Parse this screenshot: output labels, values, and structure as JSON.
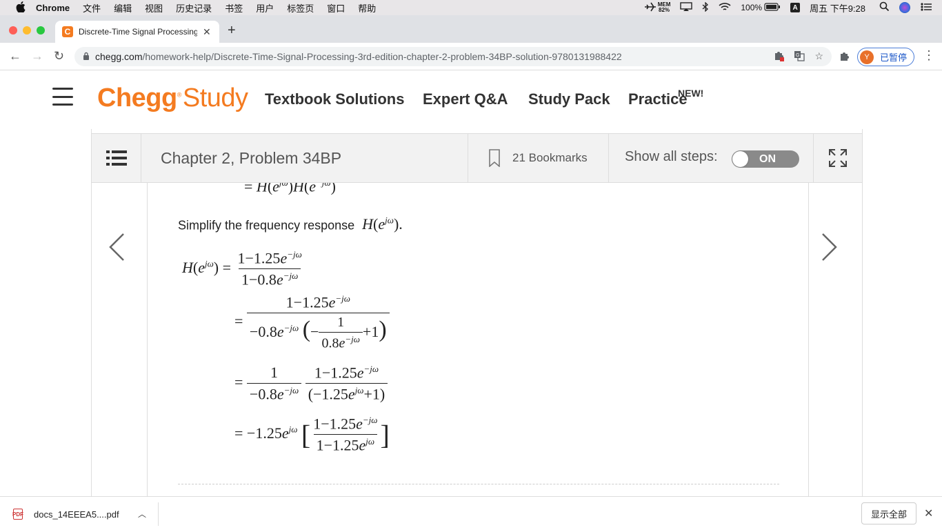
{
  "menubar": {
    "app": "Chrome",
    "items": [
      "文件",
      "编辑",
      "视图",
      "历史记录",
      "书签",
      "用户",
      "标签页",
      "窗口",
      "帮助"
    ],
    "mem_label": "MEM",
    "mem_value": "82%",
    "battery": "100%",
    "input_method": "A",
    "clock": "周五 下午9:28"
  },
  "browser": {
    "tab_title": "Discrete-Time Signal Processing",
    "url_domain": "chegg.com",
    "url_path": "/homework-help/Discrete-Time-Signal-Processing-3rd-edition-chapter-2-problem-34BP-solution-9780131988422",
    "profile_initial": "Y",
    "profile_label": "已暂停"
  },
  "chegg": {
    "logo_chegg": "Chegg",
    "logo_study": "Study",
    "nav": [
      "Textbook Solutions",
      "Expert Q&A",
      "Study Pack",
      "Practice"
    ],
    "new_badge": "NEW!"
  },
  "viewer": {
    "chapter_title": "Chapter 2, Problem 34BP",
    "bookmarks": "21 Bookmarks",
    "show_steps_label": "Show all steps:",
    "toggle_state": "ON"
  },
  "solution": {
    "prose": "Simplify the frequency response"
  },
  "downloads": {
    "filename": "docs_14EEEA5....pdf",
    "show_all": "显示全部"
  }
}
